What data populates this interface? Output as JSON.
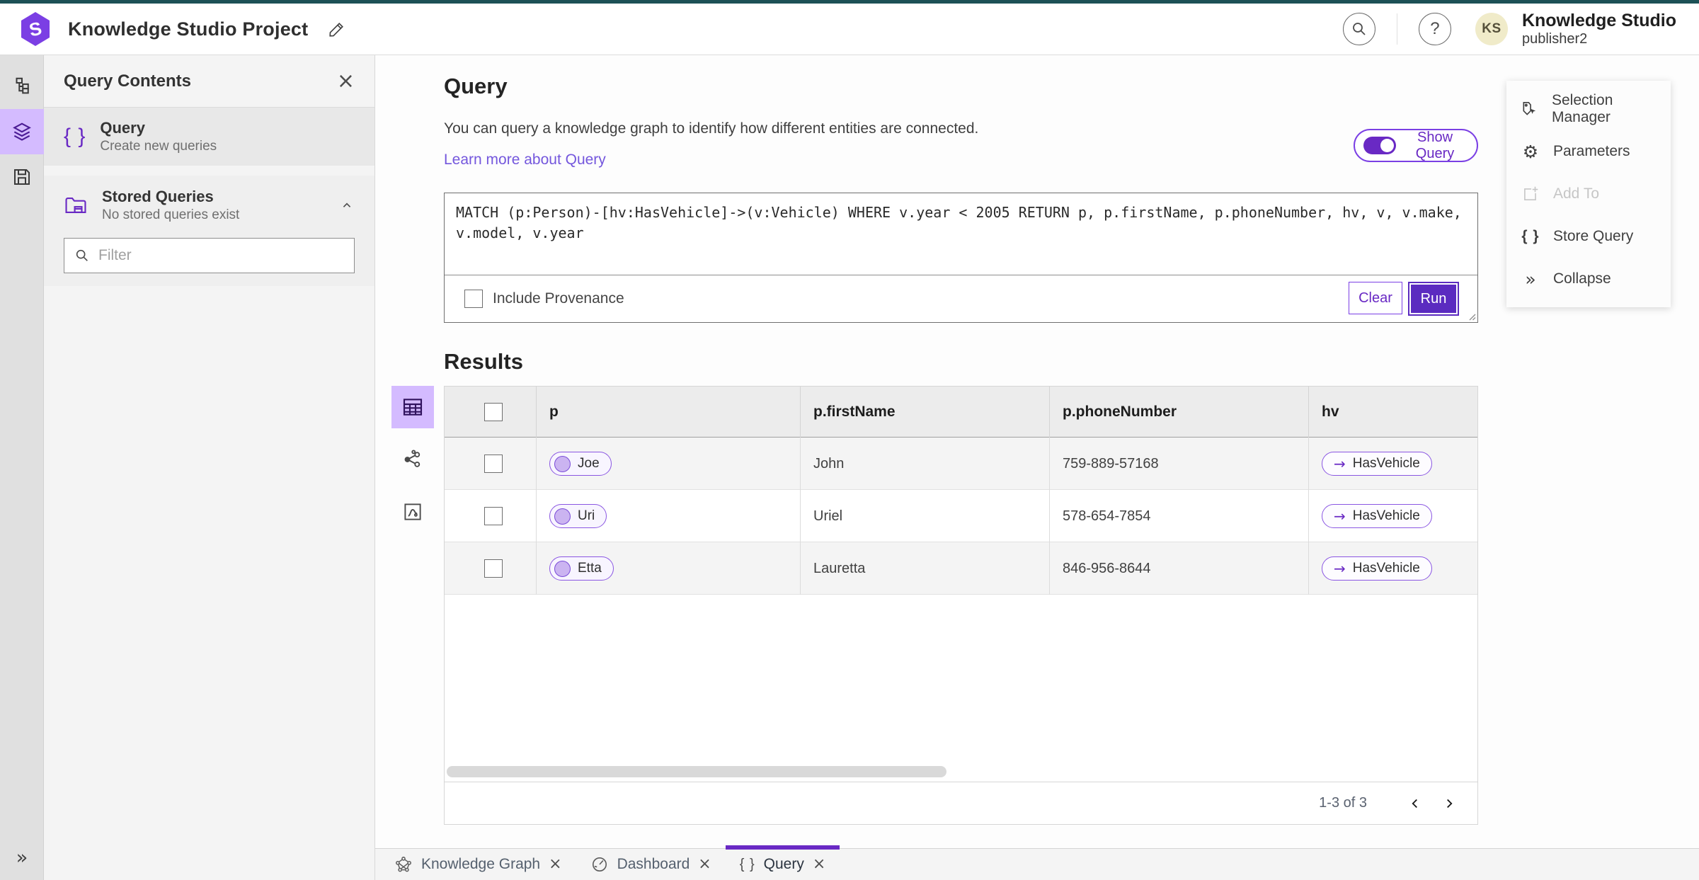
{
  "header": {
    "title": "Knowledge Studio Project",
    "user": {
      "initials": "KS",
      "name": "Knowledge Studio",
      "role": "publisher2"
    }
  },
  "glyphs": {
    "close": "×",
    "help": "?",
    "braces": "{ }",
    "arrow_right": "→",
    "gear": "⚙",
    "collapse": "»",
    "rail_expand": "»"
  },
  "contents_panel": {
    "title": "Query Contents",
    "query_item": {
      "title": "Query",
      "subtitle": "Create new queries"
    },
    "stored_queries": {
      "title": "Stored Queries",
      "subtitle": "No stored queries exist"
    },
    "filter": {
      "placeholder": "Filter"
    }
  },
  "query_section": {
    "title": "Query",
    "description": "You can query a knowledge graph to identify how different entities are connected.",
    "learn_more_label": "Learn more about Query",
    "show_query_label": "Show Query",
    "query_text": "MATCH (p:Person)-[hv:HasVehicle]->(v:Vehicle) WHERE v.year < 2005 RETURN p, p.firstName, p.phoneNumber, hv, v, v.make, v.model, v.year",
    "include_provenance_label": "Include Provenance",
    "clear_label": "Clear",
    "run_label": "Run"
  },
  "results": {
    "title": "Results",
    "columns": [
      "p",
      "p.firstName",
      "p.phoneNumber",
      "hv"
    ],
    "rows": [
      {
        "p": "Joe",
        "firstName": "John",
        "phone": "759-889-57168",
        "hv": "HasVehicle"
      },
      {
        "p": "Uri",
        "firstName": "Uriel",
        "phone": "578-654-7854",
        "hv": "HasVehicle"
      },
      {
        "p": "Etta",
        "firstName": "Lauretta",
        "phone": "846-956-8644",
        "hv": "HasVehicle"
      }
    ],
    "pagination": {
      "range_label": "1-3 of 3"
    }
  },
  "actions_panel": {
    "items": [
      {
        "label": "Selection Manager"
      },
      {
        "label": "Parameters"
      },
      {
        "label": "Add To"
      },
      {
        "label": "Store Query"
      },
      {
        "label": "Collapse"
      }
    ]
  },
  "tabs": [
    {
      "label": "Knowledge Graph"
    },
    {
      "label": "Dashboard"
    },
    {
      "label": "Query"
    }
  ],
  "colors": {
    "accent_purple": "#6929c4",
    "run_button": "#5b2bc0",
    "active_light_purple": "#d4bbff",
    "top_accent_teal": "#1d5156",
    "avatar_bg": "#f0ebc9",
    "link": "#7457dd"
  }
}
